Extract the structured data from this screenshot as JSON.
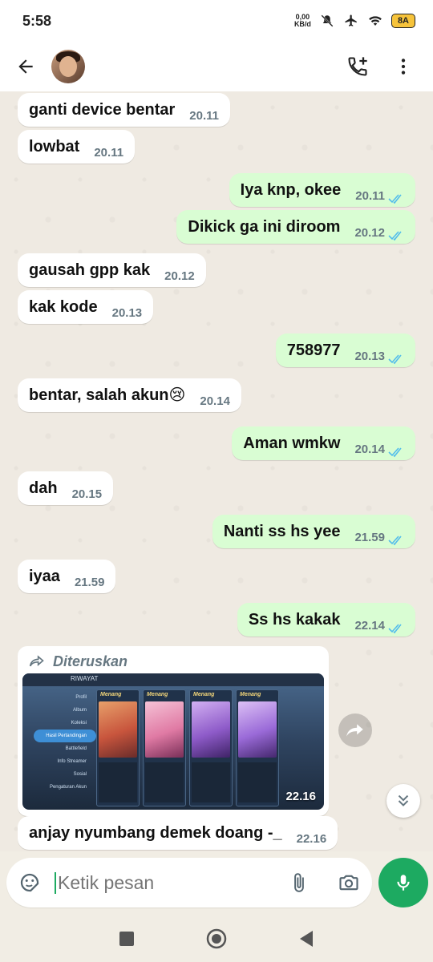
{
  "status_bar": {
    "time": "5:58",
    "net_speed_value": "0,00",
    "net_speed_unit": "KB/d",
    "battery": "8A"
  },
  "contact": {
    "avatar": "contact-photo"
  },
  "messages": [
    {
      "dir": "in",
      "text": "ganti device bentar",
      "time": "20.11"
    },
    {
      "dir": "in",
      "text": "lowbat",
      "time": "20.11"
    },
    {
      "dir": "out",
      "text": "Iya knp, okee",
      "time": "20.11",
      "status": "read"
    },
    {
      "dir": "out",
      "text": "Dikick ga ini diroom",
      "time": "20.12",
      "status": "read"
    },
    {
      "dir": "in",
      "text": "gausah gpp kak",
      "time": "20.12"
    },
    {
      "dir": "in",
      "text": "kak kode",
      "time": "20.13"
    },
    {
      "dir": "out",
      "text": "758977",
      "time": "20.13",
      "status": "read"
    },
    {
      "dir": "in",
      "text": "bentar, salah akun😢",
      "time": "20.14"
    },
    {
      "dir": "out",
      "text": "Aman wmkw",
      "time": "20.14",
      "status": "read"
    },
    {
      "dir": "in",
      "text": "dah",
      "time": "20.15"
    },
    {
      "dir": "out",
      "text": "Nanti ss hs yee",
      "time": "21.59",
      "status": "read"
    },
    {
      "dir": "in",
      "text": "iyaa",
      "time": "21.59"
    },
    {
      "dir": "out",
      "text": "Ss hs kakak",
      "time": "22.14",
      "status": "read"
    }
  ],
  "forwarded": {
    "label": "Diteruskan",
    "time": "22.16",
    "screenshot": {
      "title": "RIWAYAT",
      "menu": [
        "Profil",
        "Album",
        "Koleksi",
        "Hasil Pertandingan",
        "Battlefield",
        "Info Streamer",
        "Sosial",
        "Pengaturan Akun"
      ],
      "selected_index": 3,
      "card_result": "Menang",
      "card_colors": [
        "#c8553d",
        "#e07aa4",
        "#8e5bc9",
        "#9a6ad8"
      ]
    }
  },
  "last_message": {
    "text": "anjay nyumbang demek doang -_",
    "time": "22.16"
  },
  "composer": {
    "placeholder": "Ketik pesan"
  },
  "colors": {
    "accent": "#1daa61",
    "outgoing": "#d9fdd3",
    "incoming": "#ffffff",
    "tick_read": "#53bdeb"
  }
}
